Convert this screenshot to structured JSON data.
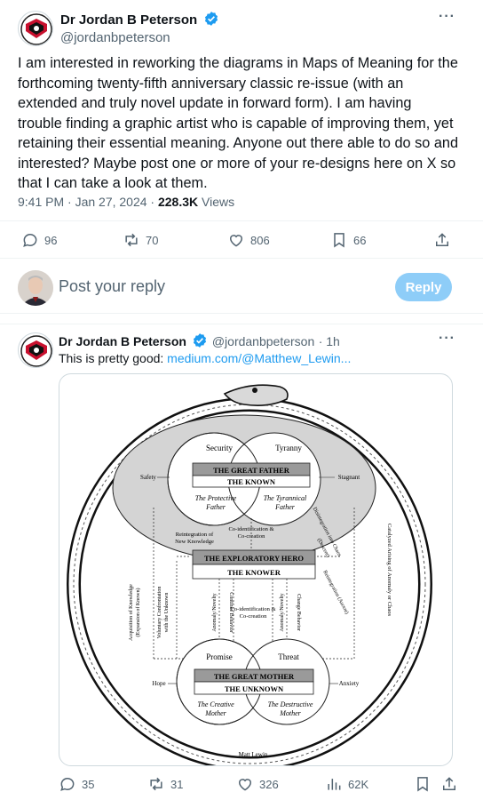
{
  "main_tweet": {
    "author_name": "Dr Jordan B Peterson",
    "author_handle": "@jordanbpeterson",
    "text": "I am interested in reworking the diagrams in Maps of Meaning for the forthcoming twenty-fifth anniversary classic re-issue (with an extended and truly novel update in forward form). I am having trouble finding a graphic artist who is capable of improving them, yet retaining their essential meaning. Anyone out there able to do so and interested? Maybe post  one or more of your re-designs here on X so that I can take a look at them.",
    "time": "9:41 PM · Jan 27, 2024 · ",
    "views_count": "228.3K",
    "views_label": " Views",
    "actions": {
      "replies": "96",
      "reposts": "70",
      "likes": "806",
      "bookmarks": "66"
    }
  },
  "composer": {
    "placeholder": "Post your reply",
    "reply_button": "Reply"
  },
  "reply_tweet": {
    "author_name": "Dr Jordan B Peterson",
    "author_handle": "@jordanbpeterson",
    "age": "· 1h",
    "text_prefix": "This is pretty good: ",
    "link": "medium.com/@Matthew_Lewin...",
    "actions": {
      "replies": "35",
      "reposts": "31",
      "likes": "326",
      "views": "62K"
    }
  },
  "diagram": {
    "security": "Security",
    "tyranny": "Tyranny",
    "great_father": "THE GREAT FATHER",
    "the_known": "THE KNOWN",
    "protective_father_1": "The Protective",
    "protective_father_2": "Father",
    "tyrannical_father_1": "The Tyrannical",
    "tyrannical_father_2": "Father",
    "safety": "Safety",
    "stagnant": "Stagnant",
    "reintegration_1": "Reintegration of",
    "reintegration_2": "New Knowledge",
    "coid_1": "Co-identification &",
    "coid_2": "Co-creation",
    "exploratory_hero": "THE EXPLORATORY HERO",
    "the_knower": "THE KNOWER",
    "disintegration": "Disintegration into Chaos",
    "descent": "(Descent)",
    "reintegration_ascent": "Reintegration (Ascent)",
    "catalyzed": "Catalyzed Arising of Anomaly or Chaos",
    "acquisition": "Acquisition of Knowledge",
    "acquisition_2": "(Expansion of Known)",
    "voluntary": "Voluntary Confrontation",
    "voluntary_2": "with the Unknown",
    "anomaly_novelty": "Anomaly/Novelty",
    "continue_behavior": "Continue Behavior",
    "change_behavior": "Change Behavior",
    "coid_mid_1": "Co-identification &",
    "coid_mid_2": "Co-creation",
    "promise": "Promise",
    "threat": "Threat",
    "great_mother": "THE GREAT MOTHER",
    "the_unknown": "THE UNKNOWN",
    "creative_mother_1": "The Creative",
    "creative_mother_2": "Mother",
    "destructive_mother_1": "The Destructive",
    "destructive_mother_2": "Mother",
    "hope": "Hope",
    "anxiety": "Anxiety",
    "signature": "Matt Lewin"
  },
  "colors": {
    "accent": "#1d9bf0",
    "reply_button_disabled": "#8ecdf8",
    "secondary_text": "#536471"
  }
}
